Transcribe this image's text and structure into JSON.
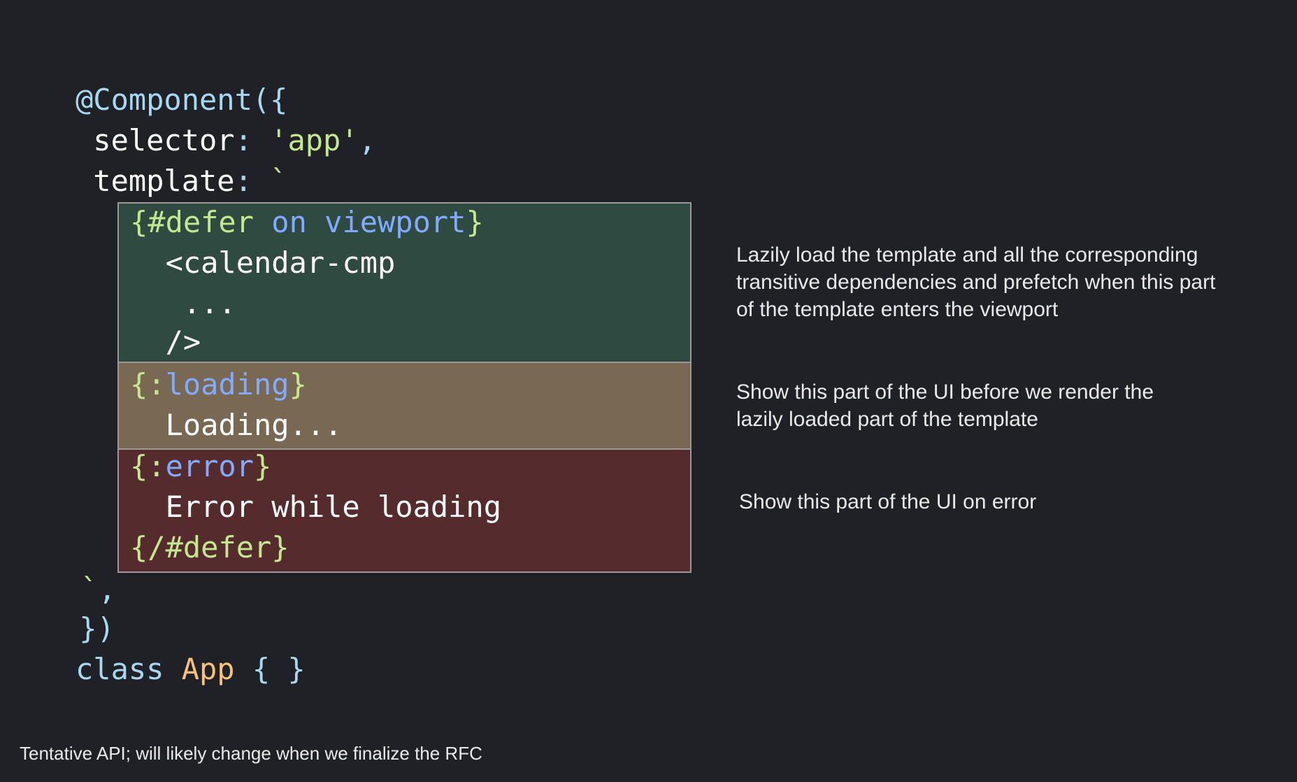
{
  "code": {
    "decorator": "@Component",
    "open_paren_brace": "({",
    "selector_key": " selector",
    "selector_colon": ": ",
    "selector_value": "'app'",
    "selector_comma": ",",
    "template_key": " template",
    "template_colon": ": ",
    "backtick_open": "`",
    "defer_block": {
      "open_brace": "{#defer ",
      "trigger": "on viewport",
      "close_brace": "}",
      "tag_open": "  <calendar-cmp",
      "ellipsis": "   ...",
      "tag_close": "  />"
    },
    "loading_block": {
      "open_brace": "{:",
      "keyword": "loading",
      "close_brace": "}",
      "text": "  Loading..."
    },
    "error_block": {
      "open_brace": "{:",
      "keyword": "error",
      "close_brace": "}",
      "text": "  Error while loading",
      "end_tag": "{/#defer}"
    },
    "backtick_close": " `",
    "backtick_close_comma": ",",
    "close_brace_paren": " })",
    "class_keyword": "class ",
    "class_name": "App",
    "class_body": " { }"
  },
  "annotations": {
    "defer_note": [
      "Lazily load the template and all the corresponding",
      "transitive dependencies and prefetch when this part",
      "of the template enters the viewport"
    ],
    "loading_note": [
      "Show this part of the UI before we render the",
      "lazily loaded part of the template"
    ],
    "error_note": [
      "Show this part of the UI on error"
    ]
  },
  "footer": "Tentative API; will likely change when we finalize the RFC",
  "colors": {
    "background": "#202126",
    "defer_block": "#2e4a41",
    "loading_block": "#7a6952",
    "error_block": "#562b2e",
    "keyword": "#c3e88d",
    "accent": "#82aaff",
    "punctuation": "#a6d8f0",
    "class_name": "#f9c07a"
  }
}
